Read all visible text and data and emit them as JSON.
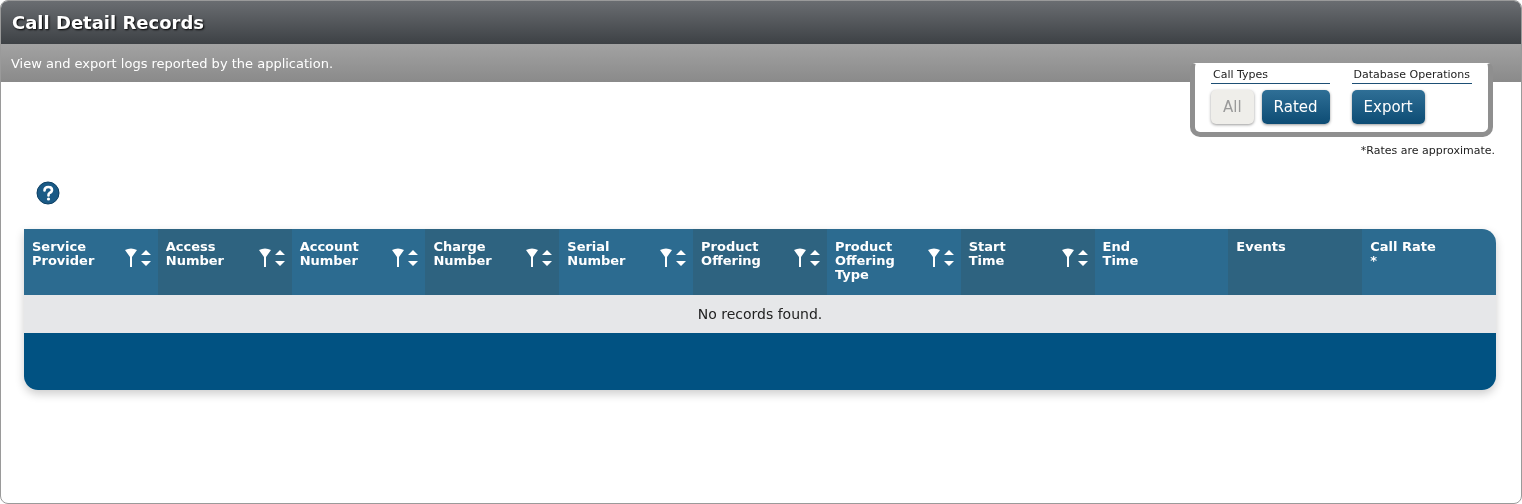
{
  "window": {
    "title": "Call Detail Records",
    "subtitle": "View and export logs reported by the application."
  },
  "toolbox": {
    "groups": [
      {
        "label": "Call Types",
        "buttons": [
          {
            "label": "All",
            "selected": true
          },
          {
            "label": "Rated",
            "selected": false
          }
        ]
      },
      {
        "label": "Database Operations",
        "buttons": [
          {
            "label": "Export",
            "selected": false
          }
        ]
      }
    ],
    "note": "*Rates are approximate."
  },
  "table": {
    "columns": [
      {
        "label": "Service\nProvider",
        "filterable": true,
        "sortable": true
      },
      {
        "label": "Access\nNumber",
        "filterable": true,
        "sortable": true
      },
      {
        "label": "Account\nNumber",
        "filterable": true,
        "sortable": true
      },
      {
        "label": "Charge\nNumber",
        "filterable": true,
        "sortable": true
      },
      {
        "label": "Serial\nNumber",
        "filterable": true,
        "sortable": true
      },
      {
        "label": "Product\nOffering",
        "filterable": true,
        "sortable": true
      },
      {
        "label": "Product\nOffering\nType",
        "filterable": true,
        "sortable": true
      },
      {
        "label": "Start\nTime",
        "filterable": true,
        "sortable": true
      },
      {
        "label": "End\nTime",
        "filterable": false,
        "sortable": false
      },
      {
        "label": "Events",
        "filterable": false,
        "sortable": false
      },
      {
        "label": "Call Rate\n*",
        "filterable": false,
        "sortable": false
      }
    ],
    "empty_message": "No records found."
  }
}
